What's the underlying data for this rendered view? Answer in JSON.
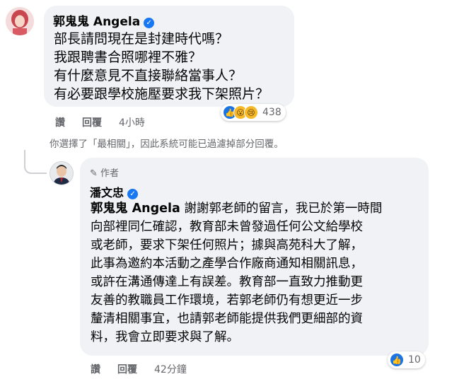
{
  "comment": {
    "author": "郭鬼鬼 Angela",
    "lines": [
      "部長請問現在是封建時代嗎？",
      "我跟聘書合照哪裡不雅？",
      "有什麼意見不直接聯絡當事人？",
      "有必要跟學校施壓要求我下架照片？"
    ],
    "actions": {
      "like": "讚",
      "reply": "回覆",
      "time": "4小時"
    },
    "reactions": {
      "count": "438",
      "types": [
        "like-icon",
        "wow-icon",
        "sad-icon"
      ]
    }
  },
  "filter_notice": "你選擇了「最相關」，因此系統可能已過濾掉部分回覆。",
  "reply": {
    "badge": "作者",
    "author": "潘文忠",
    "mention": "郭鬼鬼 Angela",
    "lines": [
      " 謝謝郭老師的留言，我已於第一時間",
      "向部裡同仁確認，教育部未曾發過任何公文給學校",
      "或老師，要求下架任何照片；據與高苑科大了解，",
      "此事為邀約本活動之產學合作廠商通知相關訊息，",
      "或許在溝通傳達上有誤差。教育部一直致力推動更",
      "友善的教職員工作環境，若郭老師仍有想更近一步",
      "釐清相關事宜，也請郭老師能提供我們更細部的資",
      "料，我會立即要求與了解。"
    ],
    "actions": {
      "like": "讚",
      "reply": "回覆",
      "time": "42分鐘"
    },
    "reactions": {
      "count": "10",
      "types": [
        "like-icon"
      ]
    }
  },
  "colors": {
    "accent": "#1877f2",
    "bubble": "#f0f2f5",
    "secondary_text": "#65676b"
  }
}
